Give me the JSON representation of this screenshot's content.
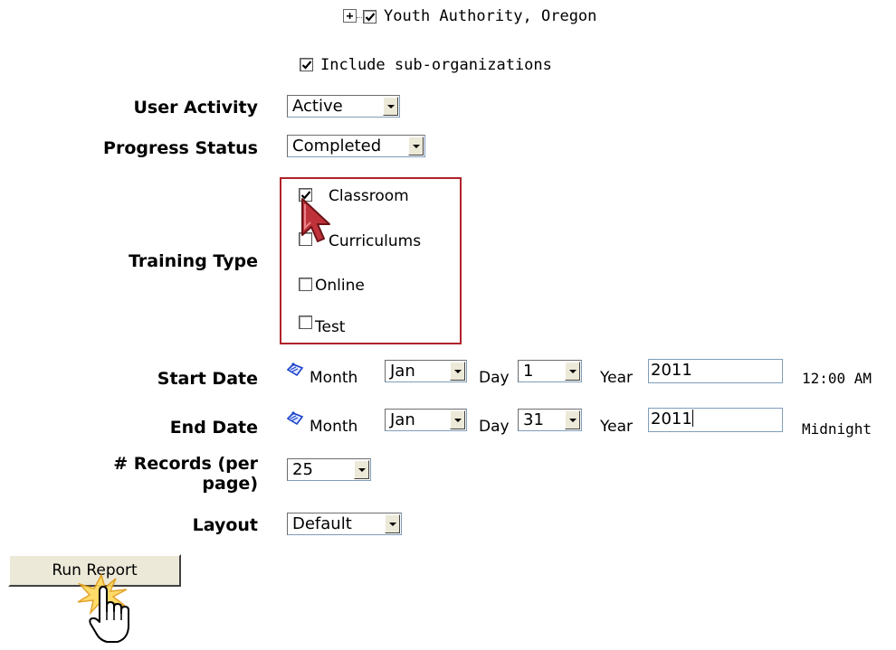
{
  "organization": {
    "label": "Youth Authority, Oregon",
    "expand_symbol": "+"
  },
  "include_sub": {
    "label": "Include sub-organizations",
    "checked": true
  },
  "user_activity": {
    "label": "User Activity",
    "value": "Active"
  },
  "progress_status": {
    "label": "Progress Status",
    "value": "Completed"
  },
  "training_type": {
    "label": "Training Type",
    "options": [
      {
        "label": "Classroom",
        "checked": true
      },
      {
        "label": "Curriculums",
        "checked": false
      },
      {
        "label": "Online",
        "checked": false
      },
      {
        "label": "Test",
        "checked": false
      }
    ],
    "highlight_color": "#b0222b"
  },
  "start_date": {
    "label": "Start Date",
    "month_label": "Month",
    "month": "Jan",
    "day_label": "Day",
    "day": "1",
    "year_label": "Year",
    "year": "2011",
    "time": "12:00 AM"
  },
  "end_date": {
    "label": "End Date",
    "month_label": "Month",
    "month": "Jan",
    "day_label": "Day",
    "day": "31",
    "year_label": "Year",
    "year": "2011",
    "time": "Midnight"
  },
  "records": {
    "label_line1": "# Records (per",
    "label_line2": "page)",
    "value": "25"
  },
  "layout": {
    "label": "Layout",
    "value": "Default"
  },
  "run_report": {
    "label": "Run Report"
  }
}
